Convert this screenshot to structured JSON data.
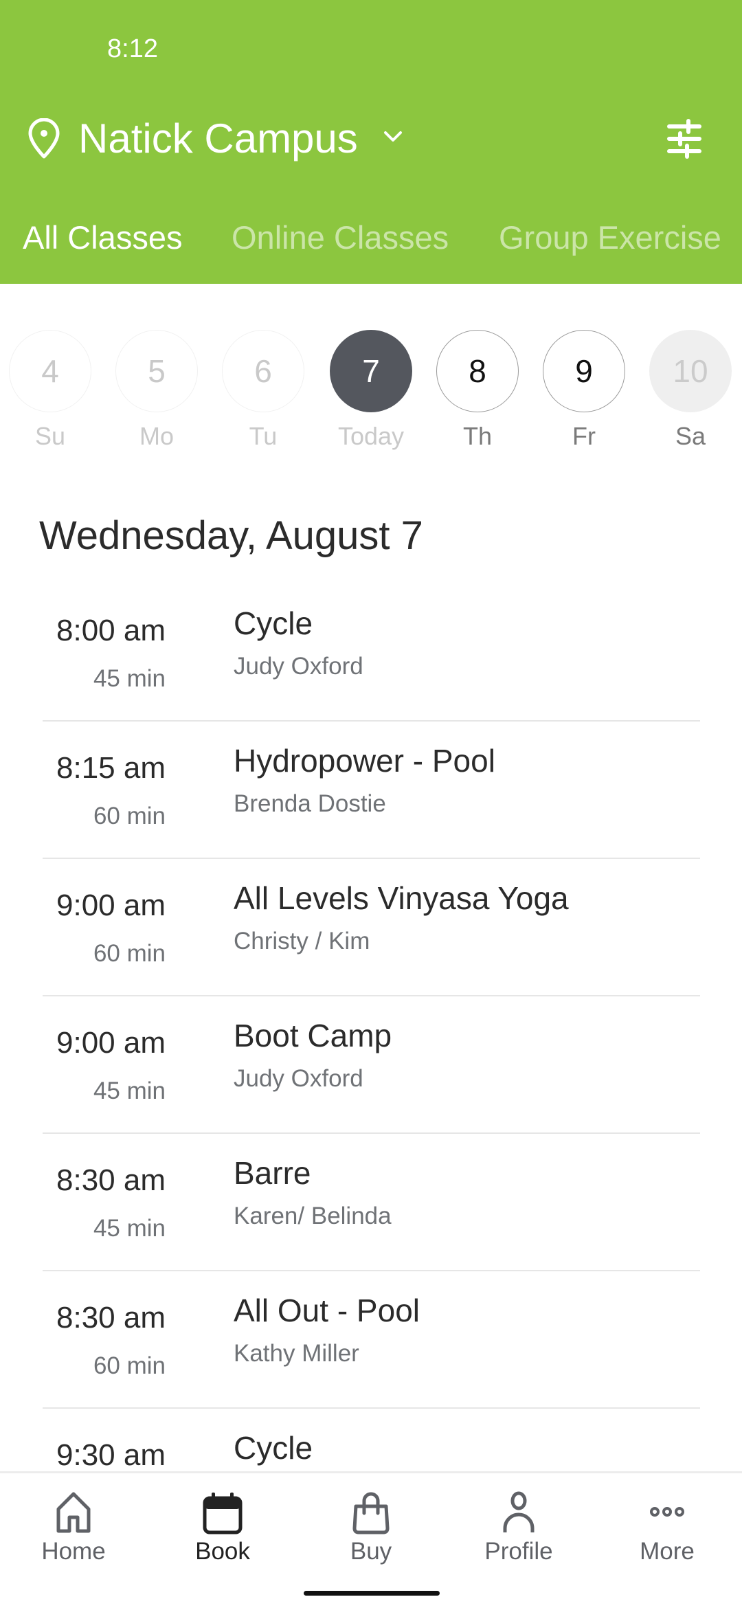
{
  "status_bar": {
    "time": "8:12"
  },
  "header": {
    "location_icon": "map-pin-icon",
    "campus": "Natick Campus",
    "dropdown_icon": "chevron-down-icon",
    "filter_icon": "sliders-icon",
    "background_color": "#8CC63F"
  },
  "tabs": [
    {
      "label": "All Classes",
      "active": true
    },
    {
      "label": "Online Classes",
      "active": false
    },
    {
      "label": "Group Exercise",
      "active": false
    }
  ],
  "week": [
    {
      "number": "4",
      "label": "Su",
      "state": "past"
    },
    {
      "number": "5",
      "label": "Mo",
      "state": "past"
    },
    {
      "number": "6",
      "label": "Tu",
      "state": "past"
    },
    {
      "number": "7",
      "label": "Today",
      "state": "today"
    },
    {
      "number": "8",
      "label": "Th",
      "state": "future"
    },
    {
      "number": "9",
      "label": "Fr",
      "state": "future"
    },
    {
      "number": "10",
      "label": "Sa",
      "state": "disabled"
    }
  ],
  "schedule": {
    "date_heading": "Wednesday, August 7",
    "classes": [
      {
        "time": "8:00 am",
        "duration": "45 min",
        "name": "Cycle",
        "instructor": "Judy Oxford"
      },
      {
        "time": "8:15 am",
        "duration": "60 min",
        "name": "Hydropower - Pool",
        "instructor": "Brenda Dostie"
      },
      {
        "time": "9:00 am",
        "duration": "60 min",
        "name": "All Levels Vinyasa Yoga",
        "instructor": "Christy / Kim"
      },
      {
        "time": "9:00 am",
        "duration": "45 min",
        "name": "Boot Camp",
        "instructor": "Judy Oxford"
      },
      {
        "time": "8:30 am",
        "duration": "45 min",
        "name": "Barre",
        "instructor": "Karen/ Belinda"
      },
      {
        "time": "8:30 am",
        "duration": "60 min",
        "name": "All Out - Pool",
        "instructor": "Kathy Miller"
      },
      {
        "time": "9:30 am",
        "duration": "",
        "name": "Cycle",
        "instructor": ""
      }
    ]
  },
  "bottom_nav": [
    {
      "label": "Home",
      "icon": "home-icon",
      "active": false
    },
    {
      "label": "Book",
      "icon": "calendar-icon",
      "active": true
    },
    {
      "label": "Buy",
      "icon": "shopping-bag-icon",
      "active": false
    },
    {
      "label": "Profile",
      "icon": "person-icon",
      "active": false
    },
    {
      "label": "More",
      "icon": "more-dots-icon",
      "active": false
    }
  ]
}
